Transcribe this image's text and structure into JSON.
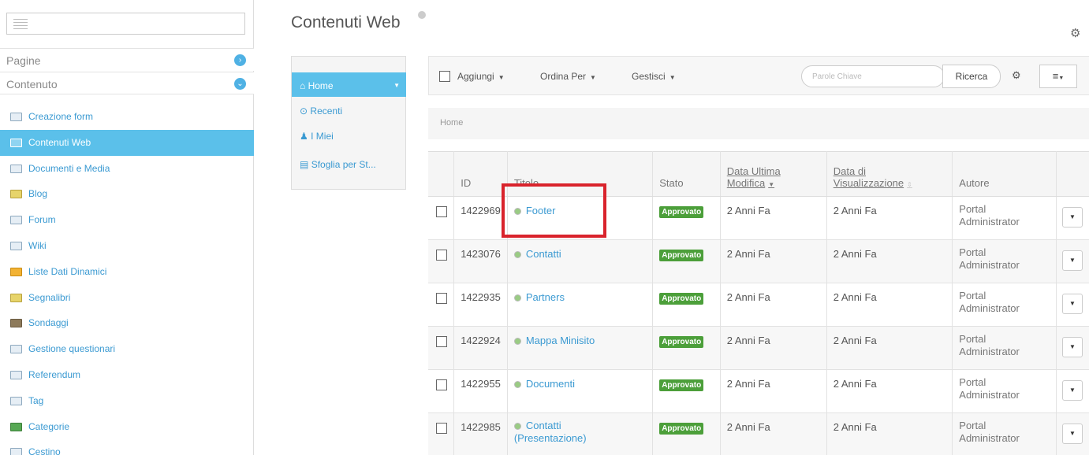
{
  "sidebar": {
    "sections": [
      {
        "label": "Pagine",
        "chevron": "chevron-right-icon"
      },
      {
        "label": "Contenuto",
        "chevron": "chevron-down-icon"
      }
    ],
    "items": [
      {
        "label": "Creazione form",
        "icon": "form-icon"
      },
      {
        "label": "Contenuti Web",
        "icon": "web-content-icon",
        "active": true
      },
      {
        "label": "Documenti e Media",
        "icon": "documents-icon"
      },
      {
        "label": "Blog",
        "icon": "blog-icon"
      },
      {
        "label": "Forum",
        "icon": "forum-icon"
      },
      {
        "label": "Wiki",
        "icon": "wiki-icon"
      },
      {
        "label": "Liste Dati Dinamici",
        "icon": "dynamic-lists-icon"
      },
      {
        "label": "Segnalibri",
        "icon": "bookmarks-icon"
      },
      {
        "label": "Sondaggi",
        "icon": "polls-icon"
      },
      {
        "label": "Gestione questionari",
        "icon": "questionnaire-icon"
      },
      {
        "label": "Referendum",
        "icon": "referendum-icon"
      },
      {
        "label": "Tag",
        "icon": "tag-icon"
      },
      {
        "label": "Categorie",
        "icon": "categories-icon"
      },
      {
        "label": "Cestino",
        "icon": "trash-icon"
      }
    ]
  },
  "main": {
    "title": "Contenuti Web"
  },
  "nav": {
    "items": [
      {
        "label": "Home",
        "icon": "home-icon",
        "glyph": "⌂"
      },
      {
        "label": "Recenti",
        "icon": "clock-icon",
        "glyph": "⊙"
      },
      {
        "label": "I Miei",
        "icon": "user-icon",
        "glyph": "♟"
      },
      {
        "label": "Sfoglia per St...",
        "icon": "browse-icon",
        "glyph": "▤"
      }
    ]
  },
  "toolbar": {
    "add": "Aggiungi",
    "order": "Ordina Per",
    "manage": "Gestisci",
    "search_placeholder": "Parole Chiave",
    "search_button": "Ricerca"
  },
  "breadcrumb": "Home",
  "table": {
    "headers": {
      "id": "ID",
      "title": "Titolo",
      "status": "Stato",
      "modified_line1": "Data Ultima",
      "modified_line2": "Modifica",
      "display_line1": "Data di",
      "display_line2": "Visualizzazione",
      "author": "Autore"
    },
    "rows": [
      {
        "id": "1422969",
        "title": "Footer",
        "status": "Approvato",
        "modified": "2 Anni Fa",
        "display": "2 Anni Fa",
        "author1": "Portal",
        "author2": "Administrator"
      },
      {
        "id": "1423076",
        "title": "Contatti",
        "status": "Approvato",
        "modified": "2 Anni Fa",
        "display": "2 Anni Fa",
        "author1": "Portal",
        "author2": "Administrator"
      },
      {
        "id": "1422935",
        "title": "Partners",
        "status": "Approvato",
        "modified": "2 Anni Fa",
        "display": "2 Anni Fa",
        "author1": "Portal",
        "author2": "Administrator"
      },
      {
        "id": "1422924",
        "title": "Mappa Minisito",
        "status": "Approvato",
        "modified": "2 Anni Fa",
        "display": "2 Anni Fa",
        "author1": "Portal",
        "author2": "Administrator"
      },
      {
        "id": "1422955",
        "title": "Documenti",
        "status": "Approvato",
        "modified": "2 Anni Fa",
        "display": "2 Anni Fa",
        "author1": "Portal",
        "author2": "Administrator"
      },
      {
        "id": "1422985",
        "title": "Contatti",
        "title2": "(Presentazione)",
        "status": "Approvato",
        "modified": "2 Anni Fa",
        "display": "2 Anni Fa",
        "author1": "Portal",
        "author2": "Administrator"
      }
    ]
  },
  "colors": {
    "accent": "#5bc0ea",
    "link": "#3b9ad2",
    "approved": "#4c9f3a",
    "highlight": "#d9232c"
  }
}
